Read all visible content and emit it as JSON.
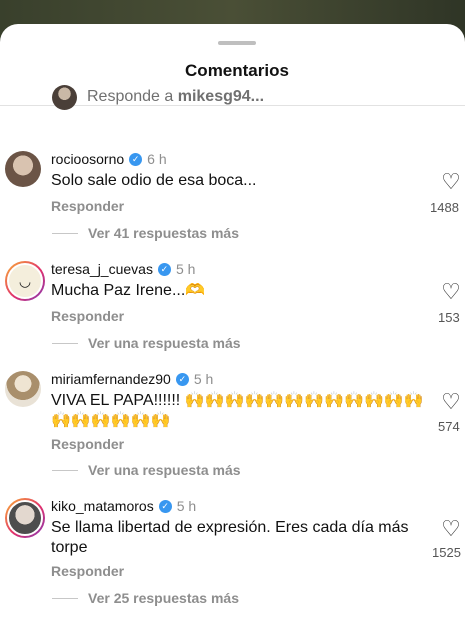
{
  "sheet": {
    "title": "Comentarios"
  },
  "reply_bar": {
    "prefix": "Responde a ",
    "username": "mikesg94..."
  },
  "comments": [
    {
      "username": "rocioosorno",
      "verified": true,
      "time": "6 h",
      "text": "Solo sale odio de esa boca...",
      "reply_label": "Responder",
      "likes": "1488",
      "more_replies": "Ver 41 respuestas más"
    },
    {
      "username": "teresa_j_cuevas",
      "verified": true,
      "time": "5 h",
      "text": "Mucha Paz Irene...🫶",
      "reply_label": "Responder",
      "likes": "153",
      "more_replies": "Ver una respuesta más"
    },
    {
      "username": "miriamfernandez90",
      "verified": true,
      "time": "5 h",
      "text": "VIVA EL PAPA!!!!!! 🙌🙌🙌🙌🙌🙌🙌🙌🙌🙌🙌🙌🙌🙌🙌🙌🙌🙌",
      "reply_label": "Responder",
      "likes": "574",
      "more_replies": "Ver una respuesta más"
    },
    {
      "username": "kiko_matamoros",
      "verified": true,
      "time": "5 h",
      "text": "Se llama libertad de expresión. Eres cada día más torpe",
      "reply_label": "Responder",
      "likes": "1525",
      "more_replies": "Ver 25 respuestas más"
    }
  ],
  "colors": {
    "verified": "#3897f0",
    "secondary_text": "#8e8e8e"
  }
}
